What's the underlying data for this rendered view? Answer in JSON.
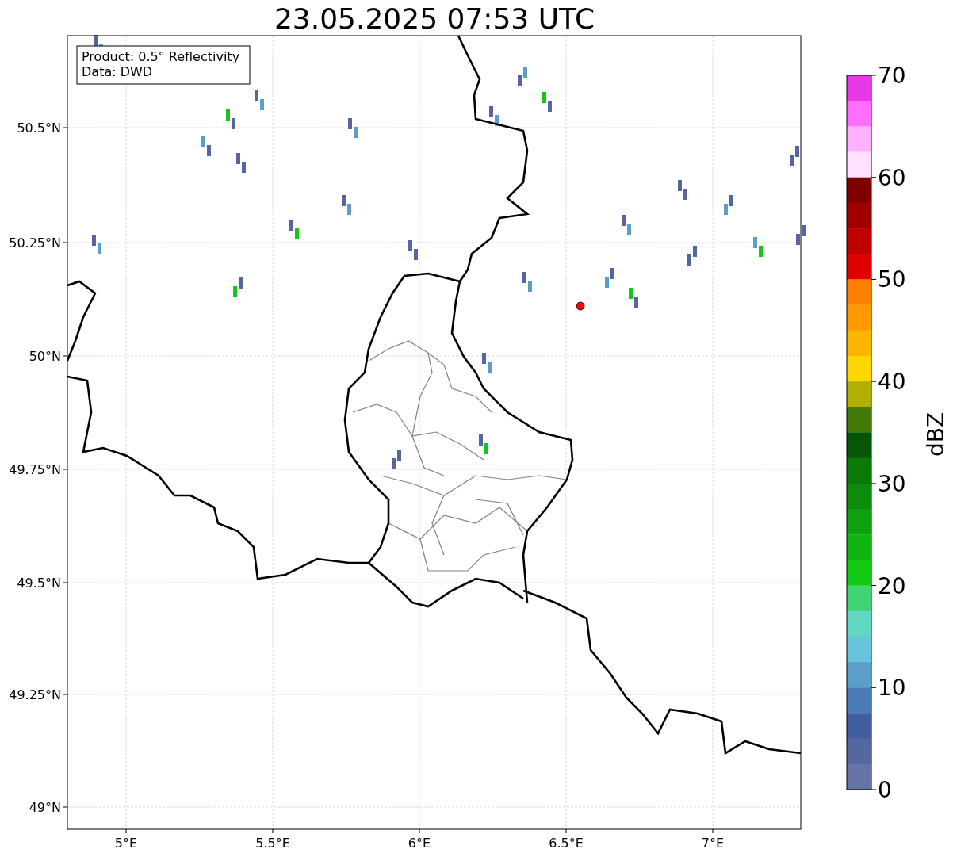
{
  "title": "23.05.2025 07:53 UTC",
  "info_box": [
    "Product: 0.5° Reflectivity",
    "Data: DWD"
  ],
  "lat_labels": [
    "50.5°N",
    "50.25°N",
    "50°N",
    "49.75°N",
    "49.5°N",
    "49.25°N",
    "49°N"
  ],
  "lon_labels": [
    "5°E",
    "5.5°E",
    "6°E",
    "6.5°E",
    "7°E"
  ],
  "colorbar": {
    "label": "dBZ",
    "ticks": [
      "70",
      "60",
      "50",
      "40",
      "30",
      "20",
      "10",
      "0"
    ],
    "segments": [
      {
        "color": "#e838e8"
      },
      {
        "color": "#ff6eff"
      },
      {
        "color": "#ffb0ff"
      },
      {
        "color": "#ffe0ff"
      },
      {
        "color": "#800000"
      },
      {
        "color": "#a00000"
      },
      {
        "color": "#c00000"
      },
      {
        "color": "#e00000"
      },
      {
        "color": "#ff7f00"
      },
      {
        "color": "#ff9a00"
      },
      {
        "color": "#ffb400"
      },
      {
        "color": "#ffd700"
      },
      {
        "color": "#b0b000"
      },
      {
        "color": "#457a0a"
      },
      {
        "color": "#075507"
      },
      {
        "color": "#0b7a0b"
      },
      {
        "color": "#0d8c0d"
      },
      {
        "color": "#0ea00e"
      },
      {
        "color": "#10b410"
      },
      {
        "color": "#12c812"
      },
      {
        "color": "#3fd572"
      },
      {
        "color": "#62d8c4"
      },
      {
        "color": "#68c3dd"
      },
      {
        "color": "#5b9ec8"
      },
      {
        "color": "#4a7bb5"
      },
      {
        "color": "#405ea0"
      },
      {
        "color": "#56669e"
      },
      {
        "color": "#6673a5"
      }
    ]
  }
}
